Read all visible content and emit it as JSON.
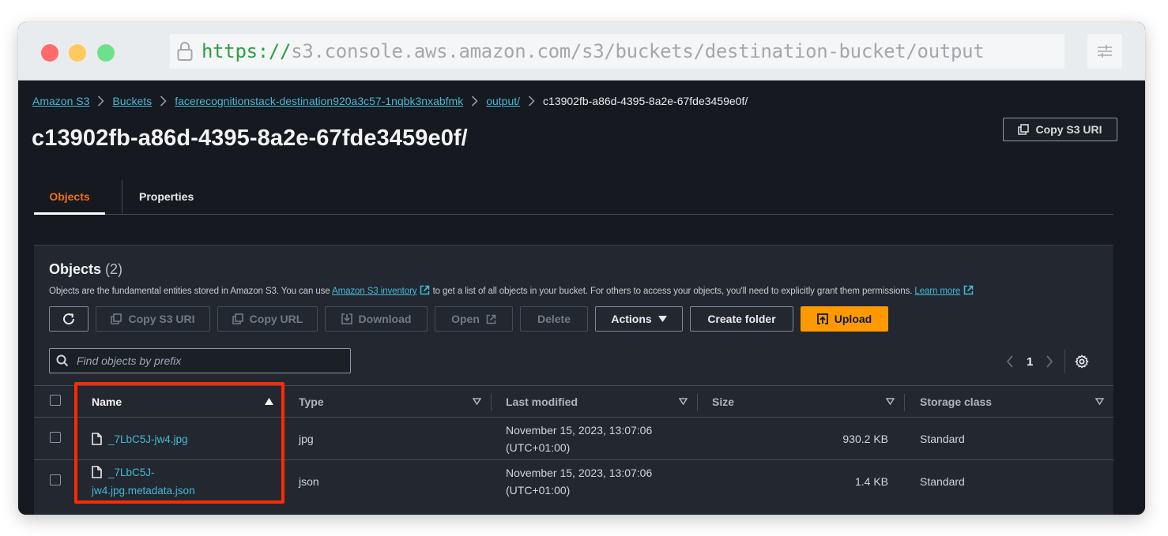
{
  "browser": {
    "url_scheme": "https://",
    "url_rest": "s3.console.aws.amazon.com/s3/buckets/destination-bucket/output",
    "lock_icon": "lock-icon",
    "settings_icon": "sliders-icon"
  },
  "breadcrumb": [
    {
      "label": "Amazon S3",
      "link": true
    },
    {
      "label": "Buckets",
      "link": true
    },
    {
      "label": "facerecognitionstack-destination920a3c57-1nqbk3nxabfmk",
      "link": true
    },
    {
      "label": "output/",
      "link": true
    },
    {
      "label": "c13902fb-a86d-4395-8a2e-67fde3459e0f/",
      "link": false
    }
  ],
  "page": {
    "title": "c13902fb-a86d-4395-8a2e-67fde3459e0f/",
    "copy_uri_label": "Copy S3 URI"
  },
  "tabs": [
    {
      "label": "Objects",
      "active": true
    },
    {
      "label": "Properties",
      "active": false
    }
  ],
  "objects_panel": {
    "title": "Objects",
    "count": "(2)",
    "desc_part1": "Objects are the fundamental entities stored in Amazon S3. You can use ",
    "desc_link1": "Amazon S3 inventory",
    "desc_part2": " to get a list of all objects in your bucket. For others to access your objects, you'll need to explicitly grant them permissions. ",
    "desc_link2": "Learn more"
  },
  "toolbar": {
    "refresh_icon": "refresh-icon",
    "copy_s3_uri": "Copy S3 URI",
    "copy_url": "Copy URL",
    "download": "Download",
    "open": "Open",
    "delete": "Delete",
    "actions": "Actions",
    "create_folder": "Create folder",
    "upload": "Upload"
  },
  "search": {
    "placeholder": "Find objects by prefix",
    "value": ""
  },
  "pagination": {
    "current_page": "1"
  },
  "table": {
    "columns": [
      "Name",
      "Type",
      "Last modified",
      "Size",
      "Storage class"
    ],
    "sorted_by": "Name",
    "sort_direction": "ascending",
    "rows": [
      {
        "name_line1": "_7LbC5J-jw4.jpg",
        "name_line2": "",
        "type": "jpg",
        "last_modified": "November 15, 2023, 13:07:06",
        "timezone": "(UTC+01:00)",
        "size": "930.2 KB",
        "storage_class": "Standard"
      },
      {
        "name_line1": "_7LbC5J-",
        "name_line2": "jw4.jpg.metadata.json",
        "type": "json",
        "last_modified": "November 15, 2023, 13:07:06",
        "timezone": "(UTC+01:00)",
        "size": "1.4 KB",
        "storage_class": "Standard"
      }
    ]
  },
  "colors": {
    "accent_orange": "#ff9900",
    "active_tab": "#ec7211",
    "link": "#44b9d6",
    "highlight_box": "#ff2a00",
    "background": "#16191f",
    "panel": "#232730"
  }
}
